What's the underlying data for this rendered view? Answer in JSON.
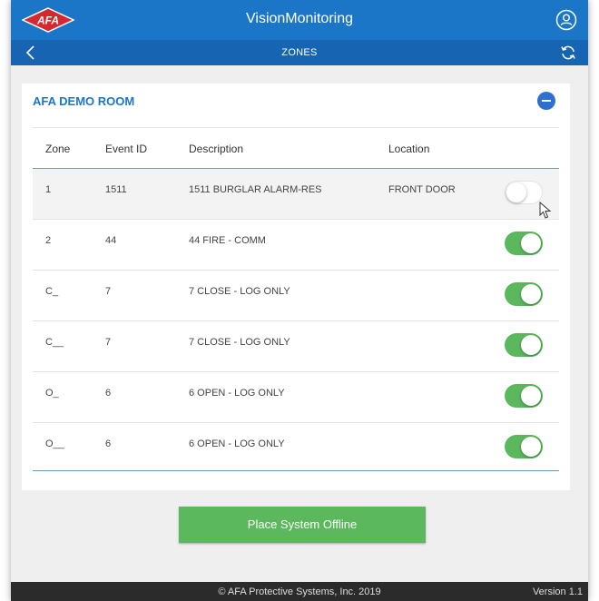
{
  "header": {
    "logo_text": "AFA",
    "app_title": "VisionMonitoring",
    "user_icon": "user-circle-icon"
  },
  "subheader": {
    "title": "ZONES",
    "back_icon": "chevron-left-icon",
    "refresh_icon": "refresh-icon"
  },
  "room": {
    "name": "AFA DEMO ROOM",
    "collapse_icon": "minus-circle-icon"
  },
  "table": {
    "headers": {
      "zone": "Zone",
      "event_id": "Event ID",
      "description": "Description",
      "location": "Location"
    },
    "rows": [
      {
        "zone": "1",
        "event_id": "1511",
        "description": "1511 BURGLAR ALARM-RES",
        "location": "FRONT DOOR",
        "enabled": false
      },
      {
        "zone": "2",
        "event_id": "44",
        "description": "44 FIRE - COMM",
        "location": "",
        "enabled": true
      },
      {
        "zone": "C_",
        "event_id": "7",
        "description": "7 CLOSE - LOG ONLY",
        "location": "",
        "enabled": true
      },
      {
        "zone": "C__",
        "event_id": "7",
        "description": "7 CLOSE - LOG ONLY",
        "location": "",
        "enabled": true
      },
      {
        "zone": "O_",
        "event_id": "6",
        "description": "6 OPEN - LOG ONLY",
        "location": "",
        "enabled": true
      },
      {
        "zone": "O__",
        "event_id": "6",
        "description": "6 OPEN - LOG ONLY",
        "location": "",
        "enabled": true
      }
    ]
  },
  "actions": {
    "offline_label": "Place System Offline"
  },
  "footer": {
    "copyright": "© AFA Protective Systems, Inc. 2019",
    "version": "Version 1.1"
  },
  "colors": {
    "header_blue": "#1b76c8",
    "subheader_blue": "#1764b2",
    "accent_green": "#5cb85c",
    "logo_red": "#d7282f"
  }
}
